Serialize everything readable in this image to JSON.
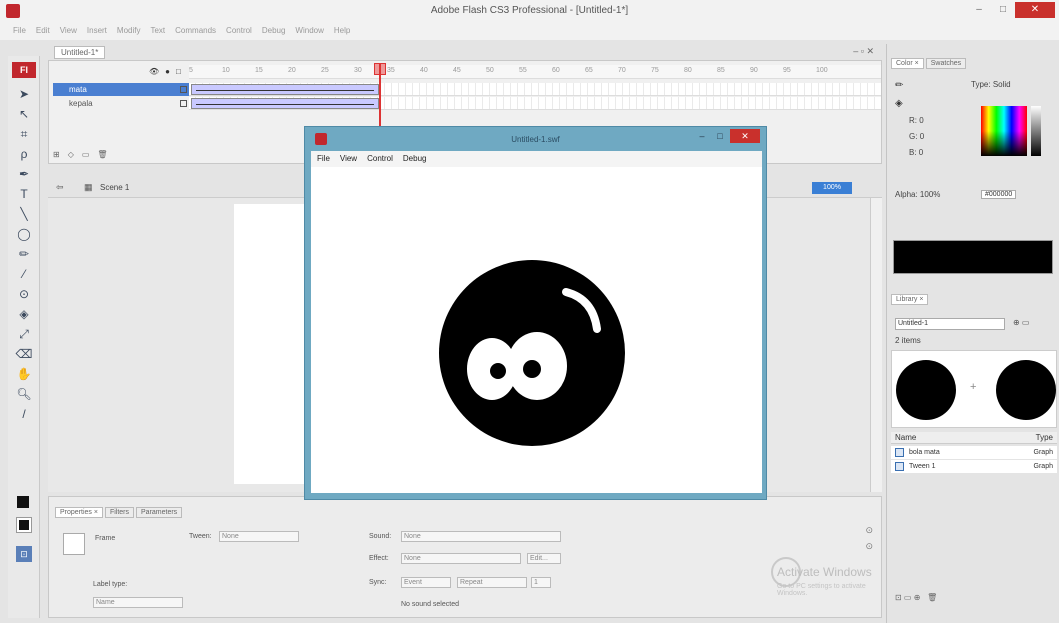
{
  "app": {
    "title": "Adobe Flash CS3 Professional - [Untitled-1*]",
    "badge": "Fl",
    "window_controls": [
      "–",
      "□",
      "✕"
    ]
  },
  "menu": [
    "File",
    "Edit",
    "View",
    "Insert",
    "Modify",
    "Text",
    "Commands",
    "Control",
    "Debug",
    "Window",
    "Help"
  ],
  "document_tab": "Untitled-1*",
  "timeline": {
    "layers": [
      {
        "name": "mata"
      },
      {
        "name": "kepala"
      }
    ],
    "frame_numbers": [
      "5",
      "10",
      "15",
      "20",
      "25",
      "30",
      "35",
      "40",
      "45",
      "50",
      "55",
      "60",
      "65",
      "70",
      "75",
      "80",
      "85",
      "90",
      "95",
      "100"
    ],
    "playhead_frame": "30"
  },
  "edit_bar": {
    "scene": "Scene 1",
    "zoom": "100%"
  },
  "color_panel": {
    "tabs": [
      "Color ×",
      "Swatches"
    ],
    "type_label": "Type:",
    "type_value": "Solid",
    "r_label": "R:",
    "r": "0",
    "g_label": "G:",
    "g": "0",
    "b_label": "B:",
    "b": "0",
    "alpha_label": "Alpha:",
    "alpha": "100%",
    "hex": "#000000",
    "fill_color": "#000000"
  },
  "library": {
    "tab": "Library ×",
    "document": "Untitled-1",
    "count": "2 items",
    "col_name": "Name",
    "col_type": "Type",
    "items": [
      {
        "name": "bola mata",
        "type": "Graph"
      },
      {
        "name": "Tween 1",
        "type": "Graph"
      }
    ]
  },
  "properties": {
    "tabs": [
      "Properties ×",
      "Filters",
      "Parameters"
    ],
    "frame_label": "Frame",
    "tween_label": "Tween:",
    "tween_value": "None",
    "label_type_label": "Label type:",
    "label_type_value": "Name",
    "sound_label": "Sound:",
    "sound_value": "None",
    "effect_label": "Effect:",
    "effect_value": "None",
    "edit_label": "Edit...",
    "sync_label": "Sync:",
    "sync_value": "Event",
    "repeat_value": "Repeat",
    "repeat_count": "1",
    "no_sound": "No sound selected"
  },
  "watermark": {
    "title": "Activate Windows",
    "subtitle": "Go to PC settings to activate Windows."
  },
  "movie_window": {
    "title": "Untitled-1.swf",
    "menu": [
      "File",
      "View",
      "Control",
      "Debug"
    ],
    "character_color": "#000000"
  }
}
